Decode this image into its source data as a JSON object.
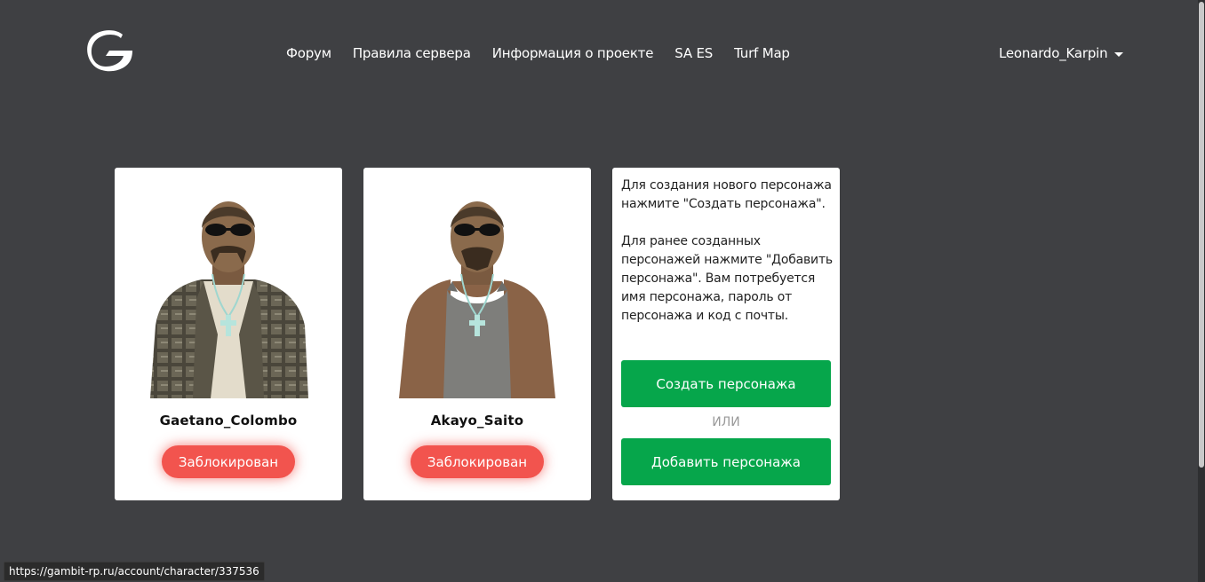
{
  "header": {
    "logo_icon": "gambit-g-logo",
    "nav": [
      {
        "label": "Форум"
      },
      {
        "label": "Правила сервера"
      },
      {
        "label": "Информация о проекте"
      },
      {
        "label": "SA ES"
      },
      {
        "label": "Turf Map"
      }
    ],
    "user": {
      "name": "Leonardo_Karpin",
      "icon": "caret-down-icon"
    }
  },
  "characters": [
    {
      "name": "Gaetano_Colombo",
      "status": "Заблокирован",
      "skin": "plaid-shirt"
    },
    {
      "name": "Akayo_Saito",
      "status": "Заблокирован",
      "skin": "grey-tank-top"
    }
  ],
  "info_panel": {
    "text1": "Для создания нового персонажа нажмите \"Создать персонажа\".",
    "text2": "Для ранее созданных персонажей нажмите \"Добавить персонажа\". Вам потребуется имя персонажа, пароль от персонажа и код с почты.",
    "create_label": "Создать персонажа",
    "or_label": "ИЛИ",
    "add_label": "Добавить персонажа"
  },
  "status_bar": {
    "url": "https://gambit-rp.ru/account/character/337536"
  },
  "colors": {
    "background": "#3f4043",
    "blocked": "#f2544e",
    "accent_green": "#06a64b"
  }
}
